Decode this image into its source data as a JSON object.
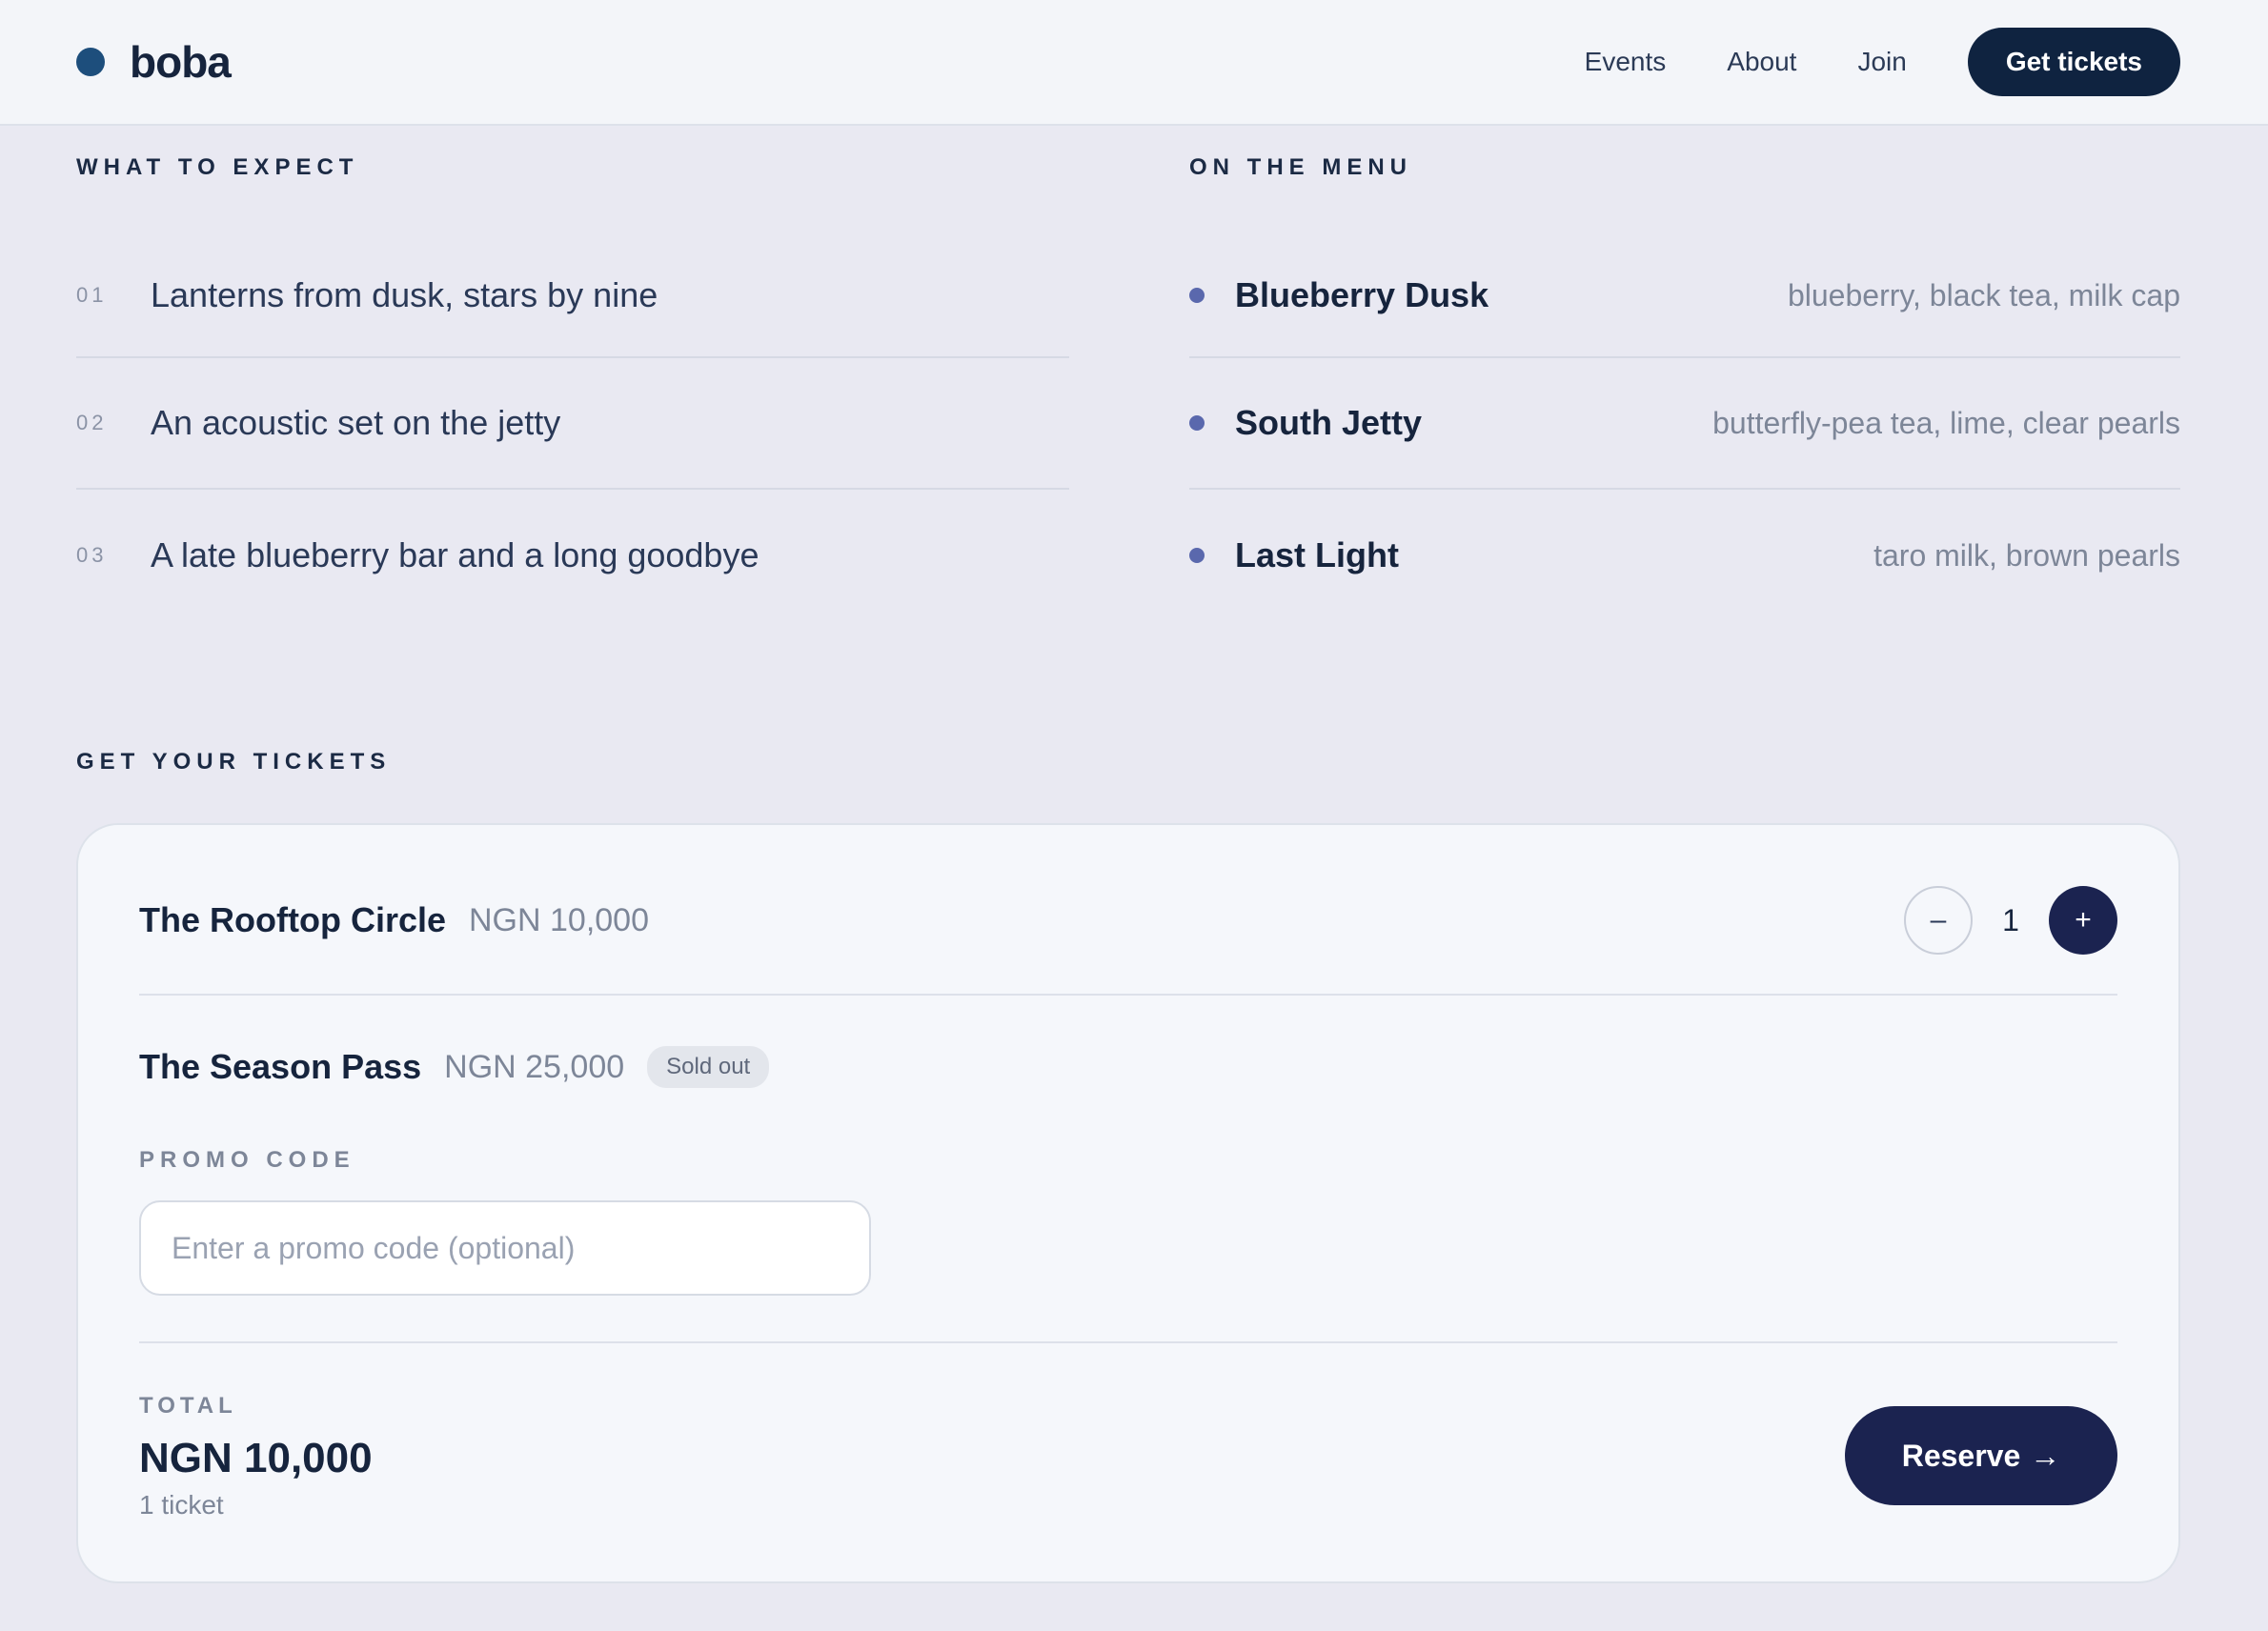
{
  "header": {
    "brand": "boba",
    "nav": [
      "Events",
      "About",
      "Join"
    ],
    "cta": "Get tickets"
  },
  "expect": {
    "label": "WHAT TO EXPECT",
    "items": [
      {
        "num": "01",
        "text": "Lanterns from dusk, stars by nine"
      },
      {
        "num": "02",
        "text": "An acoustic set on the jetty"
      },
      {
        "num": "03",
        "text": "A late blueberry bar and a long goodbye"
      }
    ]
  },
  "menu": {
    "label": "ON THE MENU",
    "items": [
      {
        "name": "Blueberry Dusk",
        "desc": "blueberry, black tea, milk cap"
      },
      {
        "name": "South Jetty",
        "desc": "butterfly-pea tea, lime, clear pearls"
      },
      {
        "name": "Last Light",
        "desc": "taro milk, brown pearls"
      }
    ]
  },
  "tickets": {
    "label": "GET YOUR TICKETS",
    "options": [
      {
        "name": "The Rooftop Circle",
        "price": "NGN 10,000",
        "quantity": "1",
        "minus": "–",
        "plus": "+"
      },
      {
        "name": "The Season Pass",
        "price": "NGN 25,000",
        "badge": "Sold out"
      }
    ],
    "promo": {
      "label": "PROMO CODE",
      "placeholder": "Enter a promo code (optional)"
    },
    "total": {
      "label": "TOTAL",
      "value": "NGN 10,000",
      "count": "1 ticket"
    },
    "reserve": "Reserve",
    "reserve_arrow": "→"
  },
  "colors": {
    "accent": "#1b2350",
    "brand_dot": "#1d4e7c",
    "menu_dot": "#5a68ad"
  }
}
